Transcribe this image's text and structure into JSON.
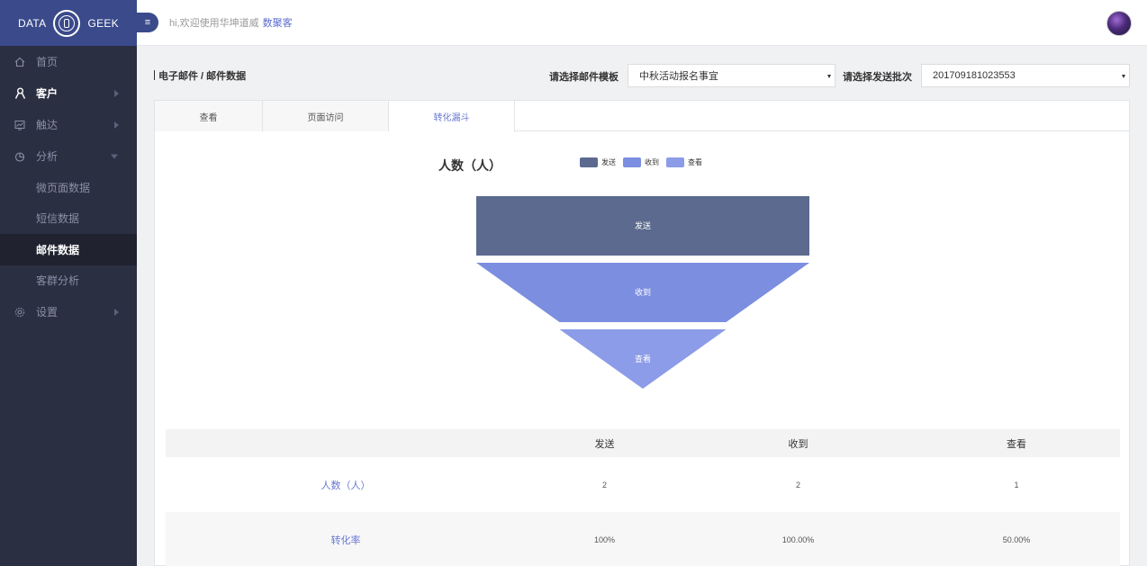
{
  "logo": {
    "left": "DATA",
    "right": "GEEK"
  },
  "header": {
    "welcome": "hi,欢迎使用华坤道威",
    "app_name": "数聚客",
    "menu_icon": "menu-icon"
  },
  "sidebar": {
    "items": [
      {
        "label": "首页",
        "icon": "home-icon"
      },
      {
        "label": "客户",
        "icon": "user-icon"
      },
      {
        "label": "触达",
        "icon": "chart-icon"
      },
      {
        "label": "分析",
        "icon": "pie-icon"
      },
      {
        "label": "设置",
        "icon": "gear-icon"
      }
    ],
    "sub_items": [
      {
        "label": "微页面数据"
      },
      {
        "label": "短信数据"
      },
      {
        "label": "邮件数据"
      },
      {
        "label": "客群分析"
      }
    ]
  },
  "toolbar": {
    "breadcrumb": "电子邮件 / 邮件数据",
    "template_label": "请选择邮件模板",
    "template_value": "中秋活动报名事宜",
    "batch_label": "请选择发送批次",
    "batch_value": "201709181023553"
  },
  "tabs": [
    {
      "label": "查看"
    },
    {
      "label": "页面访问"
    },
    {
      "label": "转化漏斗"
    }
  ],
  "chart_data": {
    "type": "funnel",
    "title": "人数（人）",
    "categories": [
      "发送",
      "收到",
      "查看"
    ],
    "values": [
      2,
      2,
      1
    ],
    "colors": [
      "#5b6a8e",
      "#7b8ee0",
      "#8c9ce8"
    ],
    "legend_position": "top"
  },
  "table": {
    "columns": [
      "",
      "发送",
      "收到",
      "查看"
    ],
    "rows": [
      {
        "label": "人数（人）",
        "cells": [
          "2",
          "2",
          "1"
        ]
      },
      {
        "label": "转化率",
        "cells": [
          "100%",
          "100.00%",
          "50.00%"
        ]
      }
    ]
  }
}
